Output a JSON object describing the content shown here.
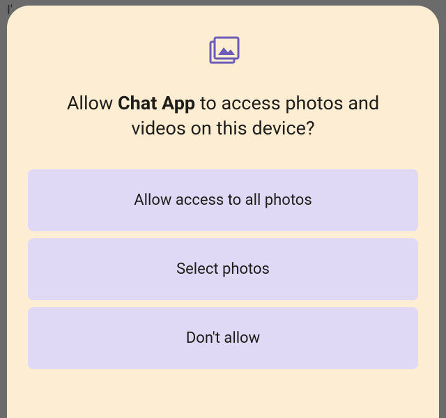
{
  "background_text": "I'",
  "dialog": {
    "title_prefix": "Allow ",
    "app_name": "Chat App",
    "title_suffix": " to access photos and videos on this device?",
    "icon_name": "photo-library-icon"
  },
  "buttons": {
    "allow_all_label": "Allow access to all photos",
    "select_label": "Select photos",
    "deny_label": "Don't allow"
  },
  "colors": {
    "dialog_bg": "#fcedd3",
    "button_bg": "#e0d9f6",
    "icon_color": "#6c5bb7"
  }
}
